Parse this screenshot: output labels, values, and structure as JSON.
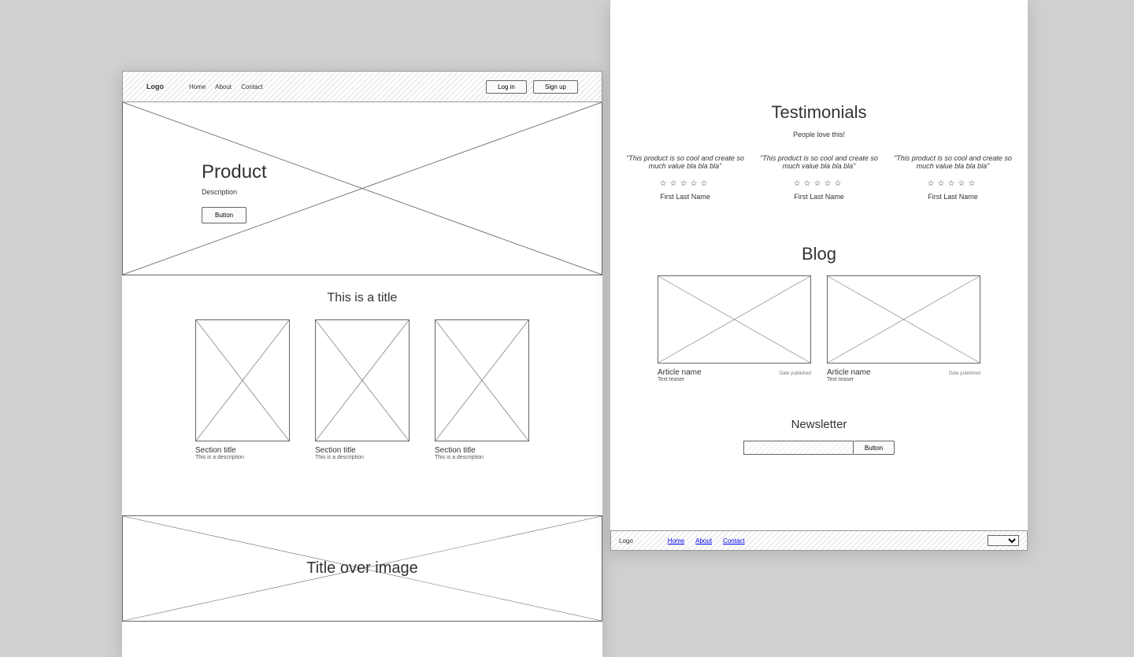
{
  "header1": {
    "logo": "Logo",
    "nav": [
      "Home",
      "About",
      "Contact"
    ],
    "login": "Log in",
    "signup": "Sign up"
  },
  "hero": {
    "title": "Product",
    "desc": "Description",
    "button": "Button"
  },
  "sections": {
    "title": "This is a title",
    "items": [
      {
        "title": "Section title",
        "desc": "This is a description"
      },
      {
        "title": "Section title",
        "desc": "This is a description"
      },
      {
        "title": "Section title",
        "desc": "This is a description"
      }
    ]
  },
  "overimage": {
    "title": "Title over image"
  },
  "testimonials": {
    "title": "Testimonials",
    "sub": "People love this!",
    "items": [
      {
        "quote": "\"This product is so cool and create so much value bla bla bla\"",
        "name": "First Last Name"
      },
      {
        "quote": "\"This product is so cool and create so much value bla bla bla\"",
        "name": "First Last Name"
      },
      {
        "quote": "\"This product is so cool and create so much value bla bla bla\"",
        "name": "First Last Name"
      }
    ]
  },
  "blog": {
    "title": "Blog",
    "items": [
      {
        "name": "Article name",
        "date": "Date published",
        "teaser": "Text teaser"
      },
      {
        "name": "Article name",
        "date": "Date published",
        "teaser": "Text teaser"
      }
    ]
  },
  "newsletter": {
    "title": "Newsletter",
    "button": "Button"
  },
  "footer": {
    "logo": "Logo",
    "nav": [
      "Home",
      "About",
      "Contact"
    ]
  }
}
